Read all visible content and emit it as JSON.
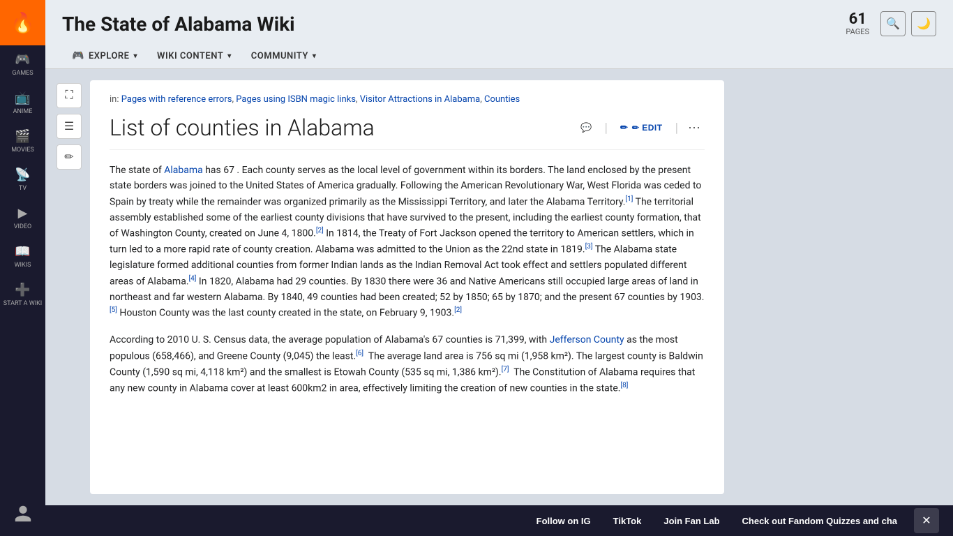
{
  "sidebar": {
    "logo_icon": "🔥",
    "items": [
      {
        "id": "games",
        "label": "GAMES",
        "icon": "🎮"
      },
      {
        "id": "anime",
        "label": "ANIME",
        "icon": "📺"
      },
      {
        "id": "movies",
        "label": "MOVIES",
        "icon": "🎬"
      },
      {
        "id": "tv",
        "label": "TV",
        "icon": "📡"
      },
      {
        "id": "video",
        "label": "VIDEO",
        "icon": "▶"
      },
      {
        "id": "wikis",
        "label": "WIKIS",
        "icon": "📖"
      },
      {
        "id": "start-a-wiki",
        "label": "START A WIKI",
        "icon": "+"
      }
    ]
  },
  "header": {
    "wiki_title": "The State of Alabama Wiki",
    "pages_number": "61",
    "pages_label": "PAGES",
    "nav": [
      {
        "id": "explore",
        "label": "EXPLORE",
        "has_chevron": true,
        "has_icon": true
      },
      {
        "id": "wiki-content",
        "label": "WIKI CONTENT",
        "has_chevron": true
      },
      {
        "id": "community",
        "label": "COMMUNITY",
        "has_chevron": true
      }
    ]
  },
  "breadcrumb": {
    "prefix": "in:",
    "links": [
      {
        "text": "Pages with reference errors"
      },
      {
        "text": "Pages using ISBN magic links"
      },
      {
        "text": "Visitor Attractions in Alabama"
      },
      {
        "text": "Counties"
      }
    ]
  },
  "article": {
    "title": "List of counties in Alabama",
    "actions": {
      "talk_label": "💬",
      "edit_label": "✏ EDIT",
      "more_label": "⋯"
    },
    "body_paragraphs": [
      "The state of Alabama has 67 . Each county serves as the local level of government within its borders. The land enclosed by the present state borders was joined to the United States of America gradually. Following the American Revolutionary War, West Florida was ceded to Spain by treaty while the remainder was organized primarily as the Mississippi Territory, and later the Alabama Territory.[1] The territorial assembly established some of the earliest county divisions that have survived to the present, including the earliest county formation, that of Washington County, created on June 4, 1800.[2] In 1814, the Treaty of Fort Jackson opened the territory to American settlers, which in turn led to a more rapid rate of county creation. Alabama was admitted to the Union as the 22nd state in 1819.[3] The Alabama state legislature formed additional counties from former Indian lands as the Indian Removal Act took effect and settlers populated different areas of Alabama.[4] In 1820, Alabama had 29 counties. By 1830 there were 36 and Native Americans still occupied large areas of land in northeast and far western Alabama. By 1840, 49 counties had been created; 52 by 1850; 65 by 1870; and the present 67 counties by 1903.[5] Houston County was the last county created in the state, on February 9, 1903.[2]",
      "According to 2010 U. S. Census data, the average population of Alabama's 67 counties is 71,399, with Jefferson County as the most populous (658,466), and Greene County (9,045) the least.[6]  The average land area is 756 sq mi (1,958 km²). The largest county is Baldwin County (1,590 sq mi, 4,118 km²) and the smallest is Etowah County (535 sq mi, 1,386 km²).[7]  The Constitution of Alabama requires that any new county in Alabama cover at least 600km2 in area, effectively limiting the creation of new counties in the state.[8]"
    ],
    "alabama_link": "Alabama",
    "jefferson_link": "Jefferson County"
  },
  "tools": [
    {
      "id": "expand",
      "icon": "⛶"
    },
    {
      "id": "toc",
      "icon": "☰"
    },
    {
      "id": "edit",
      "icon": "✏"
    }
  ],
  "bottom_banner": {
    "items": [
      {
        "id": "follow-ig",
        "label": "Follow on IG"
      },
      {
        "id": "tiktok",
        "label": "TikTok"
      },
      {
        "id": "join-fan-lab",
        "label": "Join Fan Lab"
      },
      {
        "id": "check-out-fandom",
        "label": "Check out Fandom Quizzes and cha"
      }
    ],
    "close_icon": "✕"
  }
}
